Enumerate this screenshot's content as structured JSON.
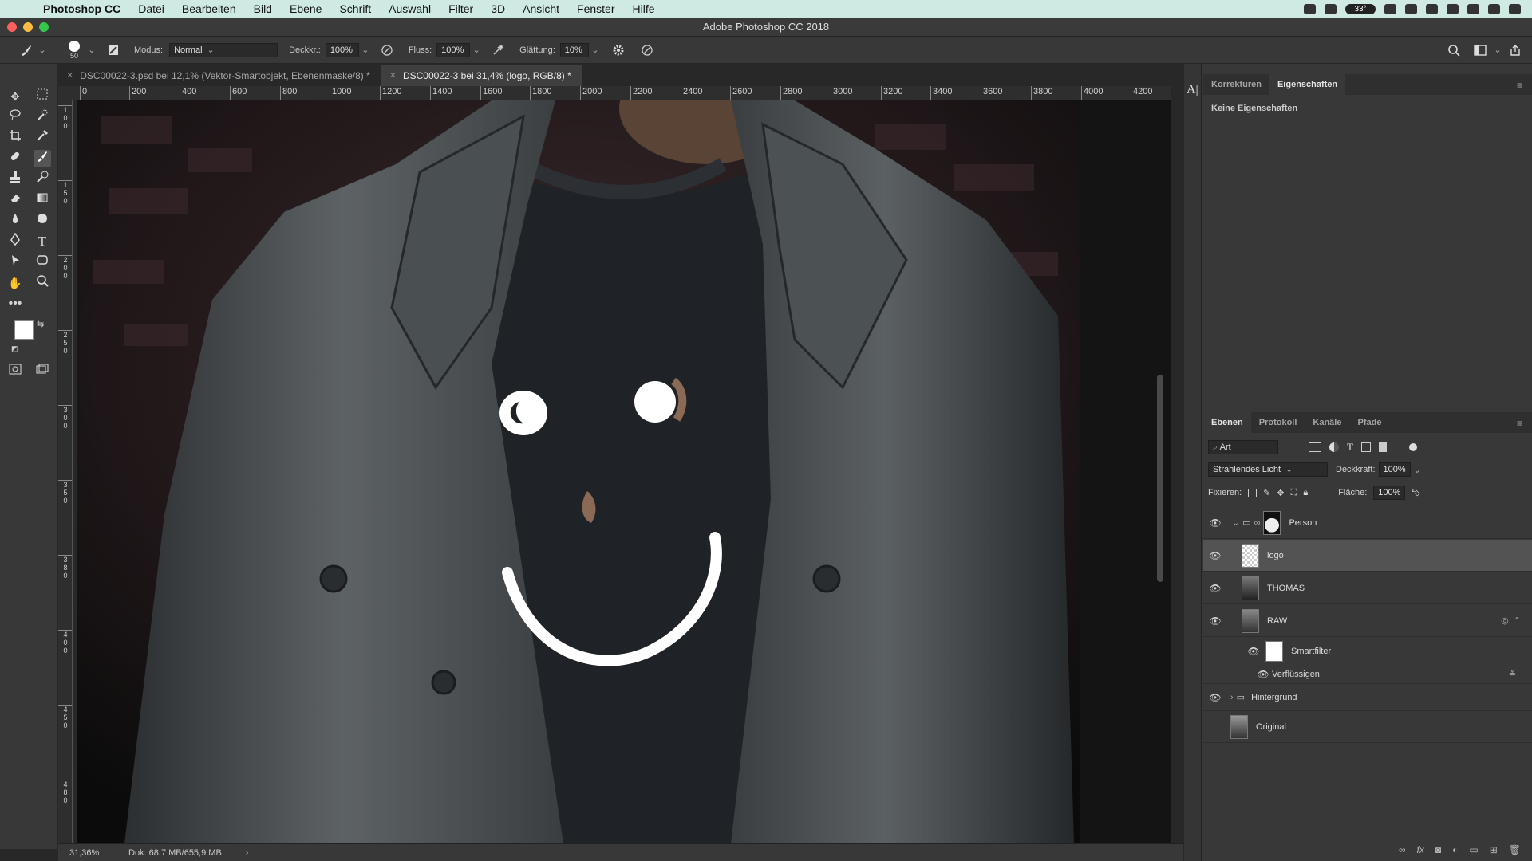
{
  "menubar": {
    "app_name": "Photoshop CC",
    "items": [
      "Datei",
      "Bearbeiten",
      "Bild",
      "Ebene",
      "Schrift",
      "Auswahl",
      "Filter",
      "3D",
      "Ansicht",
      "Fenster",
      "Hilfe"
    ],
    "temperature_badge": "33°"
  },
  "window": {
    "title": "Adobe Photoshop CC 2018"
  },
  "options": {
    "brush_size": "50",
    "mode_label": "Modus:",
    "mode_value": "Normal",
    "opacity_label": "Deckkr.:",
    "opacity_value": "100%",
    "flow_label": "Fluss:",
    "flow_value": "100%",
    "smoothing_label": "Glättung:",
    "smoothing_value": "10%"
  },
  "tabs": [
    {
      "label": "DSC00022-3.psd bei 12,1% (Vektor-Smartobjekt, Ebenenmaske/8) *"
    },
    {
      "label": "DSC00022-3 bei 31,4% (logo, RGB/8) *"
    }
  ],
  "ruler": {
    "h_ticks": [
      "0",
      "200",
      "400",
      "600",
      "800",
      "1000",
      "1200",
      "1400",
      "1600",
      "1800",
      "2000",
      "2200",
      "2400",
      "2600",
      "2800",
      "3000",
      "3200",
      "3400",
      "3600",
      "3800",
      "4000",
      "4200"
    ],
    "v_ticks": [
      "1\n0\n0",
      "1\n5\n0",
      "2\n0\n0",
      "2\n5\n0",
      "3\n0\n0",
      "3\n5\n0",
      "3\n8\n0",
      "4\n0\n0",
      "4\n5\n0",
      "4\n8\n0"
    ]
  },
  "status": {
    "zoom": "31,36%",
    "doc": "Dok: 68,7 MB/655,9 MB"
  },
  "properties_panel": {
    "tabs": [
      "Korrekturen",
      "Eigenschaften"
    ],
    "active_tab": 1,
    "empty_text": "Keine Eigenschaften"
  },
  "layers_panel": {
    "tabs": [
      "Ebenen",
      "Protokoll",
      "Kanäle",
      "Pfade"
    ],
    "active_tab": 0,
    "filter_value": "Art",
    "blend_mode": "Strahlendes Licht",
    "opacity_label": "Deckkraft:",
    "opacity_value": "100%",
    "lock_label": "Fixieren:",
    "fill_label": "Fläche:",
    "fill_value": "100%",
    "layers": [
      {
        "name": "Person",
        "type": "group"
      },
      {
        "name": "logo",
        "type": "pixel",
        "selected": true
      },
      {
        "name": "THOMAS",
        "type": "pixel"
      },
      {
        "name": "RAW",
        "type": "smart"
      },
      {
        "name": "Smartfilter",
        "type": "filtermask"
      },
      {
        "name": "Verflüssigen",
        "type": "filter"
      },
      {
        "name": "Hintergrund",
        "type": "group"
      },
      {
        "name": "Original",
        "type": "smart",
        "visible": false
      }
    ]
  },
  "colors": {
    "accent_menubar": "#cfeae2",
    "panel_bg": "#383838",
    "selected_layer": "#535353"
  }
}
